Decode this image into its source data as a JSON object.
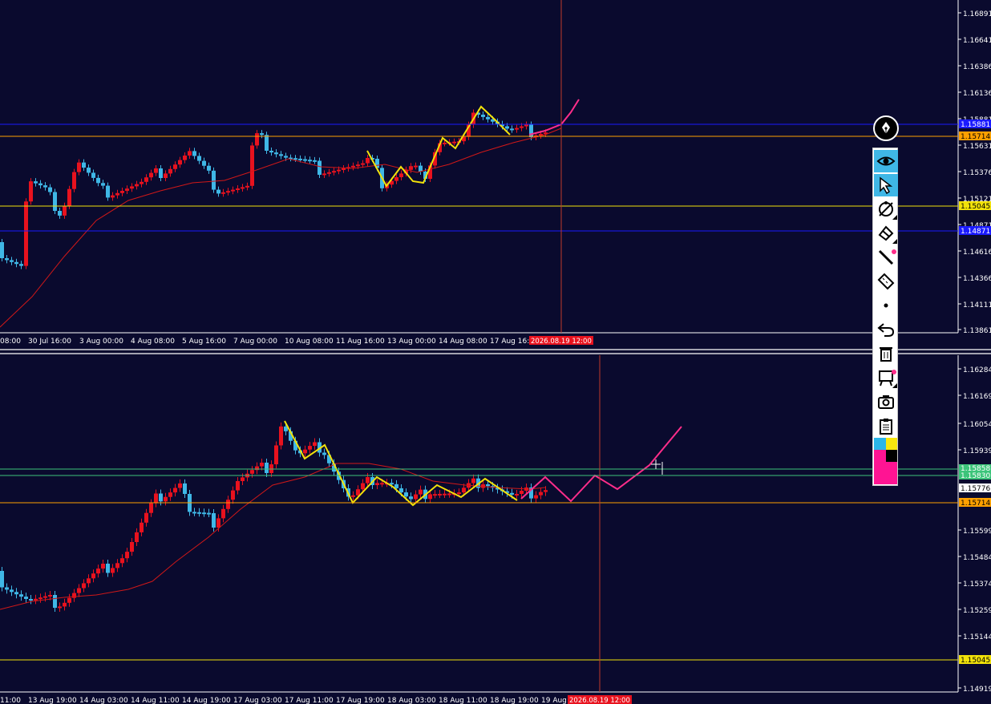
{
  "colors": {
    "background": "#0a0a2e",
    "bull_candle": "#e8121e",
    "bear_candle": "#3fb7e6",
    "moving_average": "#d01818",
    "zigzag": "#f2e20a",
    "forecast": "#ff2d8a",
    "level_orange": "#ffa000",
    "level_yellow": "#f2e20a",
    "level_blue": "#1a1aff",
    "level_green": "#3cc47a"
  },
  "top_chart": {
    "price_axis": [
      "1.16891",
      "1.16641",
      "1.16386",
      "1.16136",
      "1.15881",
      "1.15631",
      "1.15376",
      "1.15121",
      "1.14871",
      "1.14616",
      "1.14366",
      "1.14111",
      "1.13861"
    ],
    "time_axis": [
      "08:00",
      "30 Jul 16:00",
      "3 Aug 00:00",
      "4 Aug 08:00",
      "5 Aug 16:00",
      "7 Aug 00:00",
      "10 Aug 08:00",
      "11 Aug 16:00",
      "13 Aug 00:00",
      "14 Aug 08:00",
      "17 Aug 16:00"
    ],
    "cursor_time": "2026.08.19 12:00",
    "price_tags": {
      "orange": "1.15714",
      "yellow": "1.15045",
      "blue_upper": "1.15881",
      "blue_lower": "1.14871"
    }
  },
  "bottom_chart": {
    "price_axis": [
      "1.16284",
      "1.16169",
      "1.16054",
      "1.15939",
      "1.15714",
      "1.15599",
      "1.15484",
      "1.15374",
      "1.15259",
      "1.15144",
      "1.14919"
    ],
    "time_axis": [
      "11:00",
      "13 Aug 19:00",
      "14 Aug 03:00",
      "14 Aug 11:00",
      "14 Aug 19:00",
      "17 Aug 03:00",
      "17 Aug 11:00",
      "17 Aug 19:00",
      "18 Aug 03:00",
      "18 Aug 11:00",
      "18 Aug 19:00",
      "19 Aug"
    ],
    "cursor_time": "2026.08.19 12:00",
    "price_tags": {
      "green_upper": "1.15858",
      "green_lower": "1.15830",
      "bid": "1.15776",
      "orange": "1.15714",
      "yellow": "1.15045"
    }
  },
  "toolbar": {
    "logo_icon": "fountain-pen-nib-icon",
    "tools": [
      "eye-icon",
      "cursor-arrow-icon",
      "compass-icon",
      "eraser-icon",
      "line-icon",
      "ruler-icon",
      "dot-icon",
      "undo-icon",
      "trash-icon",
      "easel-icon",
      "camera-icon",
      "clipboard-icon"
    ],
    "palette": [
      "#2ab6ea",
      "#f7e70e",
      "#ff1493",
      "#000000"
    ]
  }
}
